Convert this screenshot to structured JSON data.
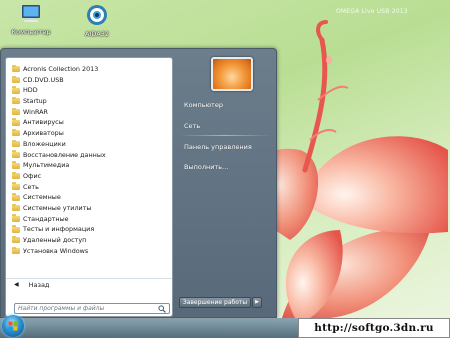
{
  "desktop": {
    "icons": [
      {
        "label": "Компьютер",
        "icon": "computer-icon"
      },
      {
        "label": "AIDA32",
        "icon": "aida-icon"
      }
    ],
    "watermark": "OMEGA Live USB 2013"
  },
  "start_menu": {
    "programs": [
      "Acronis Collection 2013",
      "CD.DVD.USB",
      "HDD",
      "Startup",
      "WinRAR",
      "Антивирусы",
      "Архиваторы",
      "Вложенцики",
      "Восстановление данных",
      "Мультимедиа",
      "Офис",
      "Сеть",
      "Системные",
      "Системные утилиты",
      "Стандартные",
      "Тесты и информация",
      "Удаленный доступ",
      "Установка Windows"
    ],
    "back_label": "Назад",
    "search_placeholder": "Найти программы и файлы",
    "right_items": {
      "computer": "Компьютер",
      "network": "Сеть",
      "control_panel": "Панель управления",
      "run": "Выполнить..."
    },
    "shutdown_label": "Завершение работы"
  },
  "overlay": {
    "url": "http://softgo.3dn.ru"
  },
  "colors": {
    "wallpaper": "#c8e6a8",
    "menu_panel": "#6c7e8c",
    "folder": "#e0b443",
    "flower": "#f07a64"
  }
}
